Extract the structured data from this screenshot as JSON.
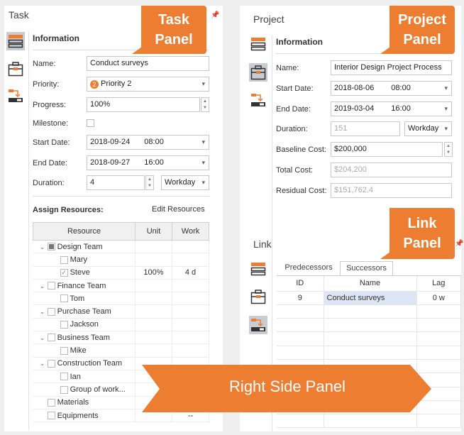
{
  "task": {
    "title": "Task",
    "info_heading": "Information",
    "fields": {
      "name_label": "Name:",
      "name_value": "Conduct surveys",
      "priority_label": "Priority:",
      "priority_badge": "2",
      "priority_value": "Priority 2",
      "progress_label": "Progress:",
      "progress_value": "100%",
      "milestone_label": "Milestone:",
      "start_label": "Start Date:",
      "start_date": "2018-09-24",
      "start_time": "08:00",
      "end_label": "End Date:",
      "end_date": "2018-09-27",
      "end_time": "16:00",
      "duration_label": "Duration:",
      "duration_value": "4",
      "duration_unit": "Workday"
    },
    "assign_heading": "Assign Resources:",
    "edit_resources": "Edit Resources",
    "columns": [
      "Resource",
      "Unit",
      "Work"
    ],
    "rows": [
      {
        "name": "Design Team",
        "level": 0,
        "expand": true,
        "check": "partial",
        "unit": "",
        "work": ""
      },
      {
        "name": "Mary",
        "level": 1,
        "check": "off",
        "unit": "",
        "work": ""
      },
      {
        "name": "Steve",
        "level": 1,
        "check": "on",
        "unit": "100%",
        "work": "4 d"
      },
      {
        "name": "Finance Team",
        "level": 0,
        "expand": true,
        "check": "off",
        "unit": "",
        "work": ""
      },
      {
        "name": "Tom",
        "level": 1,
        "check": "off",
        "unit": "",
        "work": ""
      },
      {
        "name": "Purchase Team",
        "level": 0,
        "expand": true,
        "check": "off",
        "unit": "",
        "work": ""
      },
      {
        "name": "Jackson",
        "level": 1,
        "check": "off",
        "unit": "",
        "work": ""
      },
      {
        "name": "Business Team",
        "level": 0,
        "expand": true,
        "check": "off",
        "unit": "",
        "work": ""
      },
      {
        "name": "Mike",
        "level": 1,
        "check": "off",
        "unit": "",
        "work": ""
      },
      {
        "name": "Construction Team",
        "level": 0,
        "expand": true,
        "check": "off",
        "unit": "",
        "work": ""
      },
      {
        "name": "Ian",
        "level": 1,
        "check": "off",
        "unit": "",
        "work": ""
      },
      {
        "name": "Group of work...",
        "level": 1,
        "check": "off",
        "unit": "",
        "work": ""
      },
      {
        "name": "Materials",
        "level": 0,
        "expand": false,
        "check": "off",
        "unit": "",
        "work": ""
      },
      {
        "name": "Equipments",
        "level": 0,
        "expand": false,
        "check": "off",
        "unit": "",
        "work": "--"
      }
    ]
  },
  "project": {
    "title": "Project",
    "info_heading": "Information",
    "fields": {
      "name_label": "Name:",
      "name_value": "Interior Design Project Process",
      "start_label": "Start Date:",
      "start_date": "2018-08-06",
      "start_time": "08:00",
      "end_label": "End Date:",
      "end_date": "2019-03-04",
      "end_time": "16:00",
      "duration_label": "Duration:",
      "duration_value": "151",
      "duration_unit": "Workday",
      "baseline_label": "Baseline Cost:",
      "baseline_value": "$200,000",
      "total_label": "Total Cost:",
      "total_value": "$204,200",
      "residual_label": "Residual Cost:",
      "residual_value": "$151,762.4"
    }
  },
  "link": {
    "title": "Link",
    "tabs": [
      "Predecessors",
      "Successors"
    ],
    "active_tab": "Successors",
    "columns": [
      "ID",
      "Name",
      "Lag"
    ],
    "rows": [
      {
        "id": "9",
        "name": "Conduct surveys",
        "lag": "0 w"
      }
    ]
  },
  "callouts": {
    "task": [
      "Task",
      "Panel"
    ],
    "project": [
      "Project",
      "Panel"
    ],
    "link": [
      "Link",
      "Panel"
    ],
    "right": "Right Side Panel"
  },
  "colors": {
    "accent": "#ed7d31",
    "selected_cell": "#dce6f4"
  }
}
